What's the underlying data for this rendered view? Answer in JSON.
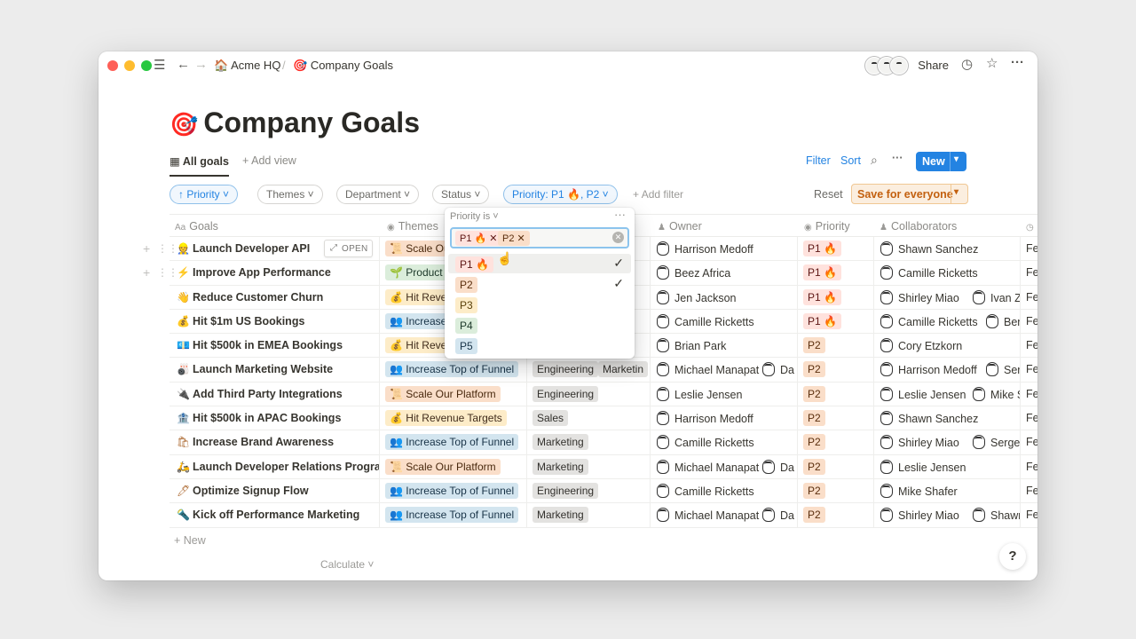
{
  "breadcrumb": {
    "workspace": "Acme HQ",
    "workspace_icon": "🏠",
    "separator": "/",
    "page": "Company Goals",
    "page_icon": "🎯"
  },
  "topbar": {
    "share": "Share"
  },
  "page": {
    "title": "Company Goals",
    "icon": "🎯"
  },
  "views": {
    "active": "All goals",
    "add": "Add view",
    "filter": "Filter",
    "sort": "Sort",
    "new": "New"
  },
  "filters": {
    "sort_pill": "↑ Priority ˅",
    "themes": "Themes ˅",
    "department": "Department ˅",
    "status": "Status ˅",
    "priority": "Priority: P1 🔥, P2 ˅",
    "add": "Add filter",
    "reset": "Reset",
    "save": "Save for everyone"
  },
  "columns": {
    "goals": "Goals",
    "themes": "Themes",
    "owner": "Owner",
    "priority": "Priority",
    "collaborators": "Collaborators"
  },
  "dropdown": {
    "header": "Priority is ˅",
    "selected": [
      "P1 🔥",
      "P2"
    ],
    "options": [
      "P1 🔥",
      "P2",
      "P3",
      "P4",
      "P5"
    ]
  },
  "rows": [
    {
      "icon": "👷",
      "goal": "Launch Developer API",
      "theme": "Scale Ou",
      "dept": "",
      "owner": "Harrison Medoff",
      "priority": "P1 🔥",
      "collab1": "Shawn Sanchez",
      "collab2": "",
      "date": "Fe"
    },
    {
      "icon": "⚡",
      "goal": "Improve App Performance",
      "theme": "Product",
      "dept": "",
      "owner": "Beez Africa",
      "priority": "P1 🔥",
      "collab1": "Camille Ricketts",
      "collab2": "",
      "date": "Fe"
    },
    {
      "icon": "👋",
      "goal": "Reduce Customer Churn",
      "theme": "Hit Reve",
      "dept": "rket",
      "owner": "Jen Jackson",
      "priority": "P1 🔥",
      "collab1": "Shirley Miao",
      "collab2": "Ivan Zha",
      "date": "Fe"
    },
    {
      "icon": "💰",
      "goal": "Hit $1m US Bookings",
      "theme": "Increase",
      "dept": "",
      "owner": "Camille Ricketts",
      "priority": "P1 🔥",
      "collab1": "Camille Ricketts",
      "collab2": "Ben",
      "date": "Fe"
    },
    {
      "icon": "💶",
      "goal": "Hit $500k in EMEA Bookings",
      "theme": "Hit Reve",
      "dept": "",
      "owner": "Brian Park",
      "priority": "P2",
      "collab1": "Cory Etzkorn",
      "collab2": "",
      "date": "Fe"
    },
    {
      "icon": "🎳",
      "goal": "Launch Marketing Website",
      "theme": "Increase Top of Funnel",
      "dept": "Engineering",
      "dept2": "Marketin",
      "owner": "Michael Manapat",
      "owner2": "Da",
      "priority": "P2",
      "collab1": "Harrison Medoff",
      "collab2": "Serg",
      "date": "Fe"
    },
    {
      "icon": "🔌",
      "goal": "Add Third Party Integrations",
      "theme": "Scale Our Platform",
      "dept": "Engineering",
      "owner": "Leslie Jensen",
      "priority": "P2",
      "collab1": "Leslie Jensen",
      "collab2": "Mike S",
      "date": "Fe"
    },
    {
      "icon": "🏦",
      "goal": "Hit $500k in APAC Bookings",
      "theme": "Hit Revenue Targets",
      "dept": "Sales",
      "owner": "Harrison Medoff",
      "priority": "P2",
      "collab1": "Shawn Sanchez",
      "collab2": "",
      "date": "Fe"
    },
    {
      "icon": "🛍",
      "goal": "Increase Brand Awareness",
      "theme": "Increase Top of Funnel",
      "dept": "Marketing",
      "owner": "Camille Ricketts",
      "priority": "P2",
      "collab1": "Shirley Miao",
      "collab2": "Sergey",
      "date": "Fe"
    },
    {
      "icon": "🛵",
      "goal": "Launch Developer Relations Program",
      "theme": "Scale Our Platform",
      "dept": "Marketing",
      "owner": "Michael Manapat",
      "owner2": "Da",
      "priority": "P2",
      "collab1": "Leslie Jensen",
      "collab2": "",
      "date": "Fe"
    },
    {
      "icon": "🖊",
      "goal": "Optimize Signup Flow",
      "theme": "Increase Top of Funnel",
      "dept": "Engineering",
      "owner": "Camille Ricketts",
      "priority": "P2",
      "collab1": "Mike Shafer",
      "collab2": "",
      "date": "Fe"
    },
    {
      "icon": "🔦",
      "goal": "Kick off Performance Marketing",
      "theme": "Increase Top of Funnel",
      "dept": "Marketing",
      "owner": "Michael Manapat",
      "owner2": "Da",
      "priority": "P2",
      "collab1": "Shirley Miao",
      "collab2": "Shawn S",
      "date": "Fe"
    }
  ],
  "row_open": "OPEN",
  "footer": {
    "new": "New",
    "calculate": "Calculate ˅",
    "help": "?"
  },
  "colors": {
    "accent": "#2383e2",
    "save_bg": "#fbeedf",
    "save_text": "#c3600f"
  }
}
